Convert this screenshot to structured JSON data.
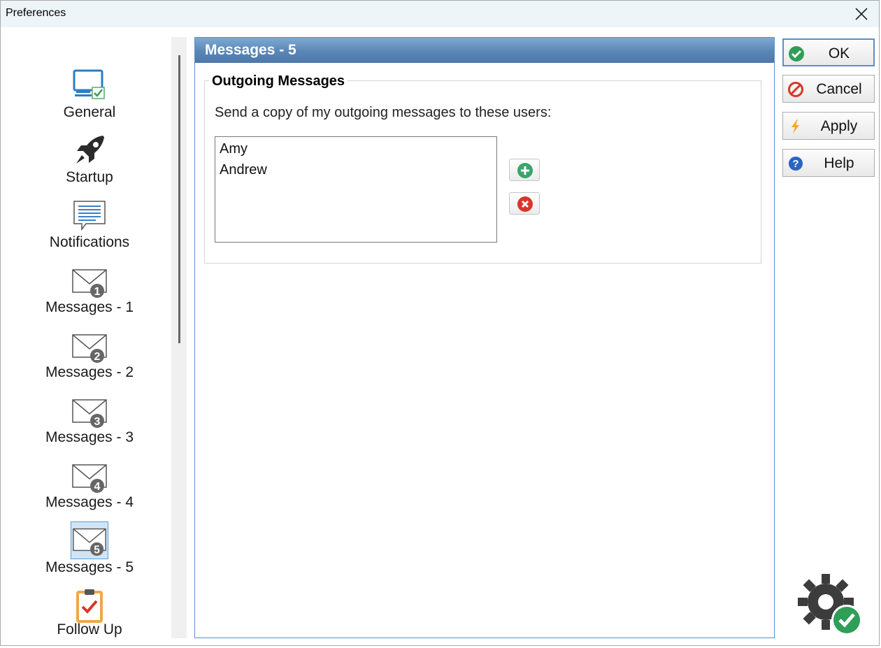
{
  "window": {
    "title": "Preferences"
  },
  "nav": {
    "items": [
      {
        "label": "General",
        "icon": "monitor-check-icon"
      },
      {
        "label": "Startup",
        "icon": "rocket-icon"
      },
      {
        "label": "Notifications",
        "icon": "message-bubble-icon"
      },
      {
        "label": "Messages - 1",
        "icon": "envelope-1-icon"
      },
      {
        "label": "Messages - 2",
        "icon": "envelope-2-icon"
      },
      {
        "label": "Messages - 3",
        "icon": "envelope-3-icon"
      },
      {
        "label": "Messages - 4",
        "icon": "envelope-4-icon"
      },
      {
        "label": "Messages - 5",
        "icon": "envelope-5-icon",
        "selected": true
      },
      {
        "label": "Follow Up",
        "icon": "clipboard-check-icon"
      }
    ],
    "badges": [
      "1",
      "2",
      "3",
      "4",
      "5"
    ]
  },
  "panel": {
    "title": "Messages - 5",
    "group_title": "Outgoing Messages",
    "description": "Send a copy of my outgoing messages to these users:",
    "users": [
      "Amy",
      "Andrew"
    ]
  },
  "buttons": {
    "ok": "OK",
    "cancel": "Cancel",
    "apply": "Apply",
    "help": "Help"
  },
  "colors": {
    "header_blue": "#5a86b5",
    "accent_blue": "#5b8fc9",
    "add_green": "#3aa56b",
    "remove_red": "#d9352b",
    "selected_bg": "#cfe5f7"
  }
}
